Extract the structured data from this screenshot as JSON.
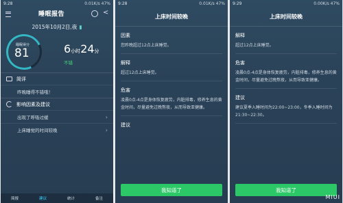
{
  "phone1": {
    "status": {
      "time": "9:28",
      "net": "0.01K/s",
      "battery": "47%"
    },
    "title": "睡眠报告",
    "date": "2015年10月2日,夜",
    "score_label": "睡眠得分",
    "score": "81",
    "hours": "6",
    "hours_unit": "小时",
    "minutes": "24",
    "minutes_unit": "分",
    "quality": "不错",
    "review_title": "简评",
    "review_item": "昨晚睡得不错哦！",
    "factors_title": "影响因素及建议",
    "factor_items": [
      "出现了呼吸过缓",
      "上床睡觉的时间较晚"
    ],
    "nav": [
      "简报",
      "建议",
      "统计",
      "备注"
    ]
  },
  "phone2": {
    "status": {
      "time": "9:28",
      "net": "0.01K/s",
      "battery": "47%"
    },
    "title": "上床时间较晚",
    "cause_label": "因素",
    "cause_text": "您昨晚超过12点上床睡觉。",
    "explain_label": "解释",
    "explain_text": "超过12点上床睡觉。",
    "harm_label": "危害",
    "harm_text": "凌晨0点-4点是身体恢复疲劳，内脏排毒，修养生息的黄金时间，尽量避免过晚熬夜，从而导致亚健康。",
    "advice_label": "建议",
    "button": "我知道了"
  },
  "phone3": {
    "status": {
      "time": "9:29",
      "net": "0.00K/s",
      "battery": "47%"
    },
    "title": "上床时间较晚",
    "explain_label": "解释",
    "explain_text": "超过12点上床睡觉。",
    "harm_label": "危害",
    "harm_text": "凌晨0点-4点是身体恢复疲劳，内脏排毒，修养生息的黄金时间，尽量避免过晚熬夜，从而导致亚健康。",
    "advice_label": "建议",
    "advice_text": "建议夏季入睡时间为22:00~23:00，冬季入睡时间为21:30~22:30。",
    "button": "我知道了"
  },
  "watermark": "MIUI"
}
